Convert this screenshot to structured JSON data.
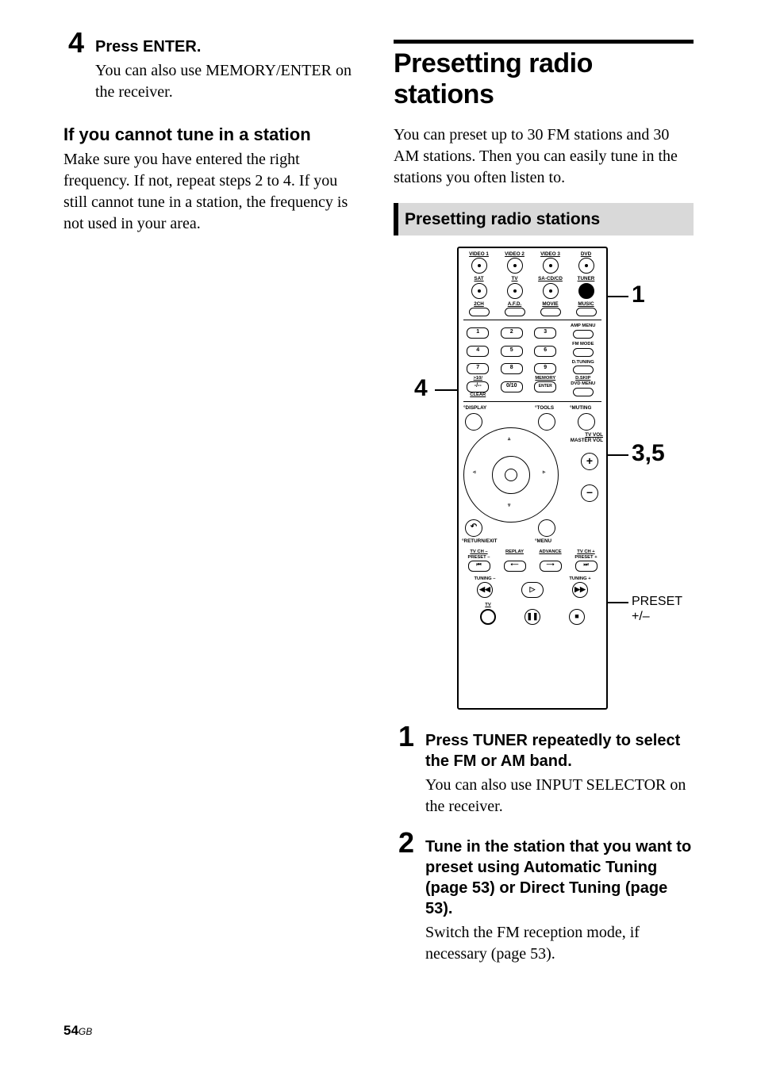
{
  "left": {
    "step4_num": "4",
    "step4_head": "Press ENTER.",
    "step4_body": "You can also use MEMORY/ENTER on the receiver.",
    "cannot_head": "If you cannot tune in a station",
    "cannot_body": "Make sure you have entered the right frequency. If not, repeat steps 2 to 4. If you still cannot tune in a station, the frequency is not used in your area."
  },
  "right": {
    "title": "Presetting radio stations",
    "intro": "You can preset up to 30 FM stations and 30 AM stations. Then you can easily tune in the stations you often listen to.",
    "subhead": "Presetting radio stations",
    "callouts": {
      "c1": "1",
      "c4": "4",
      "c35": "3,5",
      "preset": "PRESET +/–"
    },
    "steps": [
      {
        "num": "1",
        "head": "Press TUNER repeatedly to select the FM or AM band.",
        "body": "You can also use INPUT SELECTOR on the receiver."
      },
      {
        "num": "2",
        "head": "Tune in the station that you want to preset using Automatic Tuning (page 53) or Direct Tuning (page 53).",
        "body": "Switch the FM reception mode, if necessary (page 53)."
      }
    ]
  },
  "remote": {
    "row1": [
      "VIDEO 1",
      "VIDEO 2",
      "VIDEO 3",
      "DVD"
    ],
    "row2": [
      "SAT",
      "TV",
      "SA-CD/CD",
      "TUNER"
    ],
    "row3": [
      "2CH",
      "A.F.D.",
      "MOVIE",
      "MUSIC"
    ],
    "numrow1": [
      "1",
      "2",
      "3"
    ],
    "numside1": "AMP MENU",
    "numrow2": [
      "4",
      "5",
      "6"
    ],
    "numside2": "FM MODE",
    "numrow3": [
      "7",
      "8",
      "9"
    ],
    "numside3": "D.TUNING",
    "numrow4_left": ">10/",
    "numrow4_left2": "-/--",
    "numrow4_mid": "0/10",
    "numrow4_right": "MEMORY",
    "numrow4_right2": "ENTER",
    "numside4": "D.SKIP",
    "numside4b": "DVD MENU",
    "clear": "CLEAR",
    "display": "DISPLAY",
    "tools": "TOOLS",
    "muting": "MUTING",
    "tvvol": "TV VOL",
    "mastervol": "MASTER VOL",
    "returnexit": "RETURN/EXIT",
    "menu": "MENU",
    "trow_top": [
      "TV CH –",
      "REPLAY",
      "ADVANCE",
      "TV CH +"
    ],
    "trow_mid": [
      "PRESET –",
      "",
      "",
      "PRESET +"
    ],
    "tuning_minus": "TUNING –",
    "tuning_plus": "TUNING +",
    "tv": "TV"
  },
  "footer": {
    "page": "54",
    "suffix": "GB"
  }
}
